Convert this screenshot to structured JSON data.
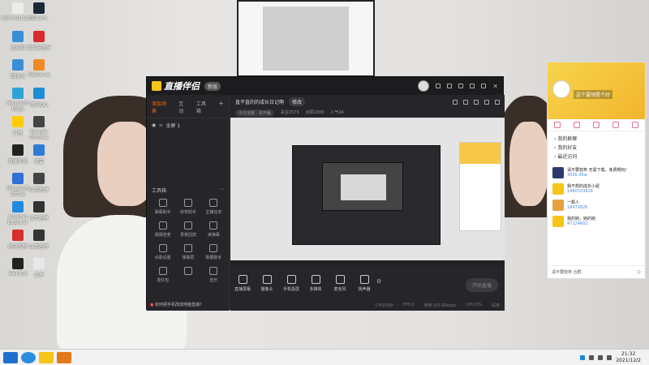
{
  "desktop_icons": [
    {
      "label": "Administrator",
      "color": "#ececec"
    },
    {
      "label": "Steam",
      "color": "#1b2838"
    },
    {
      "label": "此电脑",
      "color": "#3b8fd6"
    },
    {
      "label": "网易云音乐",
      "color": "#d82c2c"
    },
    {
      "label": "回收站",
      "color": "#3b8fd6"
    },
    {
      "label": "WeGame",
      "color": "#f08a24"
    },
    {
      "label": "Microsoft Edge",
      "color": "#2fa3d8"
    },
    {
      "label": "腾讯QQ",
      "color": "#1d8dd8"
    },
    {
      "label": "抖音",
      "color": "#ffcc00"
    },
    {
      "label": "Google Chrome",
      "color": "#444"
    },
    {
      "label": "直播伴侣",
      "color": "#222"
    },
    {
      "label": "迅雷",
      "color": "#2f7ad6"
    },
    {
      "label": "Microsoft Office",
      "color": "#2f6fd6"
    },
    {
      "label": "应用程序",
      "color": "#444"
    },
    {
      "label": "Internet Explorer",
      "color": "#1f8be0"
    },
    {
      "label": "应用程序",
      "color": "#333"
    },
    {
      "label": "腾讯视频",
      "color": "#d62f2f"
    },
    {
      "label": "应用程序",
      "color": "#333"
    },
    {
      "label": "WeChat",
      "color": "#222"
    },
    {
      "label": "文件",
      "color": "#e8e8e8"
    }
  ],
  "app": {
    "logo": "直播伴侣",
    "version": "新版",
    "side_tabs": [
      "添加场景",
      "互动",
      "工具箱"
    ],
    "scene": "全屏 1",
    "tools_title": "工具箱",
    "tools": [
      "弹幕助手",
      "房管助手",
      "主播任务",
      "视频连麦",
      "录像回放",
      "读弹幕",
      "点歌设置",
      "弹幕屏",
      "数据助手",
      "发红包",
      "",
      "音乐"
    ],
    "hint": "如何把手机改成电脑直播?",
    "live_title": "直不直的的成长日记啊",
    "edit_btn": "修改",
    "meta": [
      "今日无聊 · 未开播",
      "关注1573",
      "点赞1000",
      "人气24"
    ],
    "controls": [
      "直播屏幕",
      "摄像头",
      "手机投屏",
      "多媒体",
      "麦克风",
      "扬声器"
    ],
    "start_btn": "开始直播",
    "status": [
      "CPU/内存",
      "FPS:0",
      "帧率:0/0.00kbps",
      "CPU:0%",
      "码率"
    ]
  },
  "chat": {
    "username": "这个要领是个好",
    "menu": [
      "我的群聊",
      "我的好友",
      "最近访问"
    ],
    "contacts": [
      {
        "name": "请不要放弃 无需下载，免费畅玩!",
        "id": "3026.45w",
        "color": "#2a3a6a"
      },
      {
        "name": "我不想的成长小屋",
        "id": "1460333918",
        "color": "#f5c518"
      },
      {
        "name": "一颗人",
        "id": "18472826",
        "color": "#e8a040"
      },
      {
        "name": "我的她，她的她",
        "id": "47124602",
        "color": "#f5c518"
      }
    ],
    "footer": "请不要放弃 合群"
  },
  "taskbar": {
    "time": "21:32",
    "date": "2021/12/2"
  }
}
